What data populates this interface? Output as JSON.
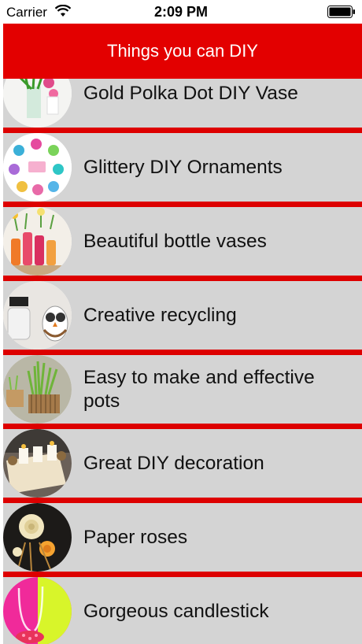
{
  "status_bar": {
    "carrier": "Carrier",
    "time": "2:09 PM"
  },
  "nav": {
    "title": "Things you can DIY"
  },
  "items": [
    {
      "label": "Gold Polka Dot DIY Vase",
      "icon": "vase-thumbnail"
    },
    {
      "label": "Glittery DIY Ornaments",
      "icon": "ornaments-thumbnail"
    },
    {
      "label": "Beautiful bottle vases",
      "icon": "bottle-vases-thumbnail"
    },
    {
      "label": "Creative recycling",
      "icon": "recycling-thumbnail"
    },
    {
      "label": "Easy to make and effective pots",
      "icon": "pots-thumbnail"
    },
    {
      "label": "Great DIY decoration",
      "icon": "decoration-thumbnail"
    },
    {
      "label": "Paper roses",
      "icon": "paper-roses-thumbnail"
    },
    {
      "label": "Gorgeous candlestick",
      "icon": "candlestick-thumbnail"
    }
  ],
  "colors": {
    "nav_background": "#e30000",
    "separator": "#dd0000",
    "row_background": "#d4d4d4"
  }
}
